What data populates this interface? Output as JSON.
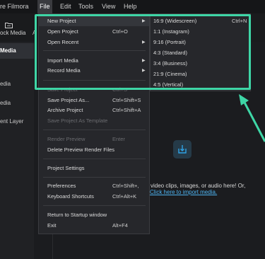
{
  "menubar": {
    "app_title": "re Filmora",
    "items": [
      "File",
      "Edit",
      "Tools",
      "View",
      "Help"
    ]
  },
  "toolbar": {
    "tab_label": "ock Media",
    "tab_label_2": "A"
  },
  "left_panel": {
    "items": [
      "Media",
      "",
      "edia",
      "edia",
      "ent Layer"
    ]
  },
  "import_area": {
    "line1": "video clips, images, or audio here! Or,",
    "link": "Click here to import media."
  },
  "file_menu": {
    "items": [
      {
        "label": "New Project",
        "shortcut": "",
        "submenu": true,
        "enabled": true
      },
      {
        "label": "Open Project",
        "shortcut": "Ctrl+O",
        "submenu": false,
        "enabled": true
      },
      {
        "label": "Open Recent",
        "shortcut": "",
        "submenu": true,
        "enabled": true
      },
      {
        "label": "Import Media",
        "shortcut": "",
        "submenu": true,
        "enabled": true
      },
      {
        "label": "Record Media",
        "shortcut": "",
        "submenu": true,
        "enabled": true
      },
      {
        "label": "Save Project",
        "shortcut": "Ctrl+S",
        "submenu": false,
        "enabled": false
      },
      {
        "label": "Save Project As...",
        "shortcut": "Ctrl+Shift+S",
        "submenu": false,
        "enabled": true
      },
      {
        "label": "Archive Project",
        "shortcut": "Ctrl+Shift+A",
        "submenu": false,
        "enabled": true
      },
      {
        "label": "Save Project As Template",
        "shortcut": "",
        "submenu": false,
        "enabled": false
      },
      {
        "label": "Render Preview",
        "shortcut": "Enter",
        "submenu": false,
        "enabled": false
      },
      {
        "label": "Delete Preview Render Files",
        "shortcut": "",
        "submenu": false,
        "enabled": true
      },
      {
        "label": "Project Settings",
        "shortcut": "",
        "submenu": false,
        "enabled": true
      },
      {
        "label": "Preferences",
        "shortcut": "Ctrl+Shift+,",
        "submenu": false,
        "enabled": true
      },
      {
        "label": "Keyboard Shortcuts",
        "shortcut": "Ctrl+Alt+K",
        "submenu": false,
        "enabled": true
      },
      {
        "label": "Return to Startup window",
        "shortcut": "",
        "submenu": false,
        "enabled": true
      },
      {
        "label": "Exit",
        "shortcut": "Alt+F4",
        "submenu": false,
        "enabled": true
      }
    ]
  },
  "new_project_submenu": {
    "items": [
      {
        "label": "16:9 (Widescreen)",
        "shortcut": "Ctrl+N"
      },
      {
        "label": "1:1 (Instagram)",
        "shortcut": ""
      },
      {
        "label": "9:16 (Portrait)",
        "shortcut": ""
      },
      {
        "label": "4:3 (Standard)",
        "shortcut": ""
      },
      {
        "label": "3:4 (Business)",
        "shortcut": ""
      },
      {
        "label": "21:9 (Cinema)",
        "shortcut": ""
      },
      {
        "label": "4:5 (Vertical)",
        "shortcut": ""
      }
    ]
  },
  "colors": {
    "highlight": "#3ed6a6",
    "link": "#4db3f0",
    "accent": "#2fa3e6"
  },
  "icons": [
    "folder-icon",
    "import-icon",
    "chevron-right-icon",
    "callout-arrow-icon"
  ]
}
